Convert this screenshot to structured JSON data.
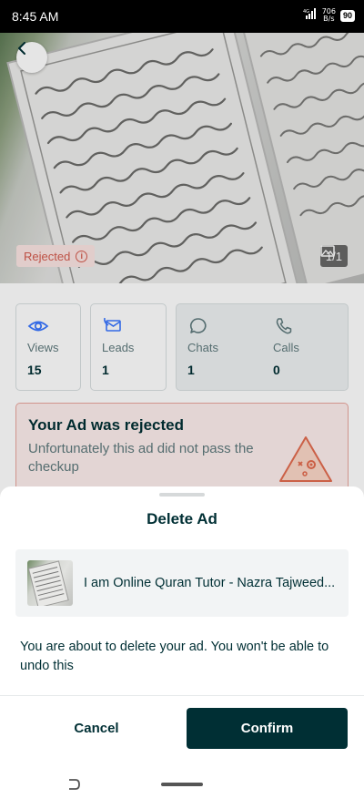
{
  "status_bar": {
    "time": "8:45 AM",
    "network": "4G",
    "speed_value": "706",
    "speed_unit": "B/s",
    "battery": "90"
  },
  "hero": {
    "status_badge": "Rejected",
    "image_counter": "1/1"
  },
  "stats": [
    {
      "label": "Views",
      "value": "15",
      "icon": "eye-icon"
    },
    {
      "label": "Leads",
      "value": "1",
      "icon": "phone-mail-icon"
    },
    {
      "label": "Chats",
      "value": "1",
      "icon": "chat-bubble-icon"
    },
    {
      "label": "Calls",
      "value": "0",
      "icon": "phone-icon"
    }
  ],
  "rejection": {
    "title": "Your Ad was rejected",
    "message": "Unfortunately this ad did not pass the checkup"
  },
  "sheet": {
    "title": "Delete Ad",
    "ad_title": "I am Online Quran Tutor - Nazra Tajweed...",
    "message": "You are about to delete your ad. You won't be able to undo this",
    "cancel_label": "Cancel",
    "confirm_label": "Confirm"
  },
  "colors": {
    "primary": "#002f34",
    "reject_red": "#d45b4e",
    "reject_bg": "#fdeeec"
  }
}
